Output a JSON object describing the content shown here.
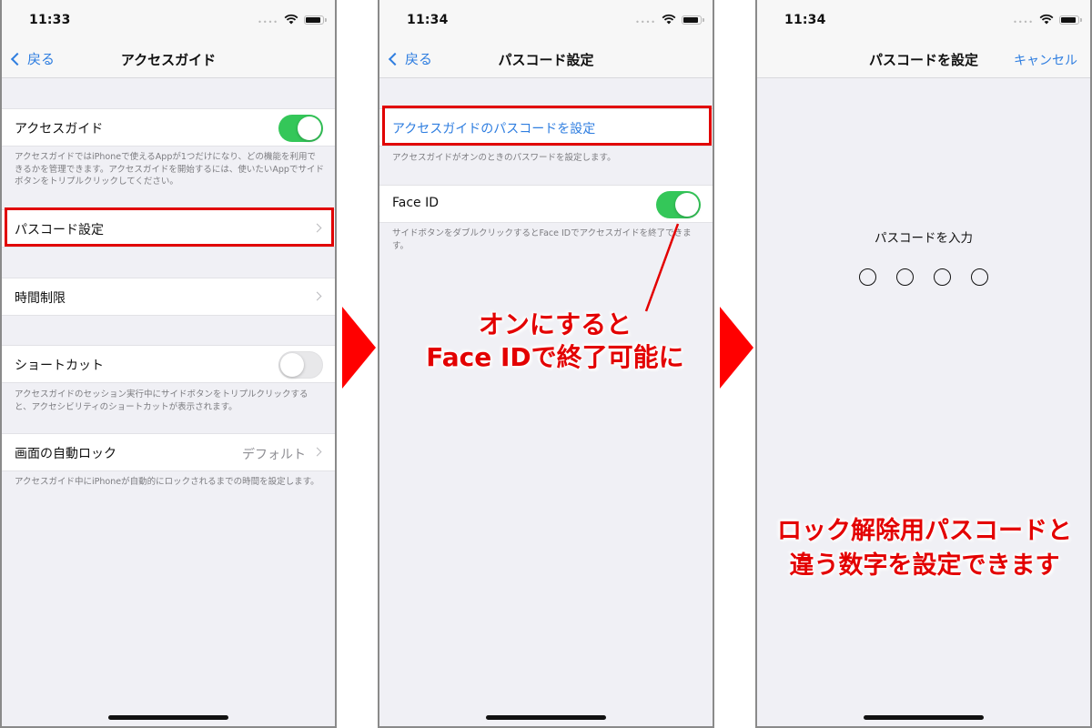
{
  "screens": [
    {
      "status": {
        "time": "11:33"
      },
      "nav": {
        "back_label": "戻る",
        "title": "アクセスガイド"
      },
      "rows": {
        "guided_access": {
          "label": "アクセスガイド",
          "toggle": "on"
        },
        "guided_access_footer": "アクセスガイドではiPhoneで使えるAppが1つだけになり、どの機能を利用できるかを管理できます。アクセスガイドを開始するには、使いたいAppでサイドボタンをトリプルクリックしてください。",
        "passcode_settings": {
          "label": "パスコード設定"
        },
        "time_limits": {
          "label": "時間制限"
        },
        "shortcut": {
          "label": "ショートカット",
          "toggle": "off"
        },
        "shortcut_footer": "アクセスガイドのセッション実行中にサイドボタンをトリプルクリックすると、アクセシビリティのショートカットが表示されます。",
        "auto_lock": {
          "label": "画面の自動ロック",
          "value": "デフォルト"
        },
        "auto_lock_footer": "アクセスガイド中にiPhoneが自動的にロックされるまでの時間を設定します。"
      }
    },
    {
      "status": {
        "time": "11:34"
      },
      "nav": {
        "back_label": "戻る",
        "title": "パスコード設定"
      },
      "rows": {
        "set_passcode": {
          "label": "アクセスガイドのパスコードを設定"
        },
        "set_passcode_footer": "アクセスガイドがオンのときのパスワードを設定します。",
        "face_id": {
          "label": "Face ID",
          "toggle": "on"
        },
        "face_id_footer": "サイドボタンをダブルクリックするとFace IDでアクセスガイドを終了できます。"
      },
      "annotation": [
        "オンにすると",
        "Face IDで終了可能に"
      ]
    },
    {
      "status": {
        "time": "11:34"
      },
      "nav": {
        "title": "パスコードを設定",
        "cancel_label": "キャンセル"
      },
      "prompt": "パスコードを入力",
      "digits_entered": 0,
      "digits_total": 4,
      "annotation": [
        "ロック解除用パスコードと",
        "違う数字を設定できます"
      ]
    }
  ],
  "colors": {
    "accent_blue": "#2f7ee0",
    "toggle_green": "#34c759",
    "highlight_red": "#e10000",
    "arrow_red": "#ff0000"
  }
}
